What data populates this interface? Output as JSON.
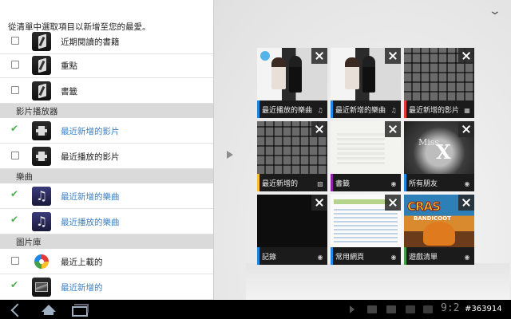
{
  "left_panel": {
    "instruction": "從清單中選取項目以新增至您的最愛。",
    "rows": [
      {
        "label": "近期閱讀的書籍",
        "checked": false,
        "icon": "books-icon",
        "style": "normal"
      },
      {
        "label": "重點",
        "checked": false,
        "icon": "books-icon",
        "style": "normal"
      },
      {
        "label": "書籤",
        "checked": false,
        "icon": "books-icon",
        "style": "normal"
      },
      {
        "label": "最近新增的影片",
        "checked": true,
        "icon": "video-icon",
        "style": "blue"
      },
      {
        "label": "最近播放的影片",
        "checked": false,
        "icon": "video-icon",
        "style": "normal"
      },
      {
        "label": "最近新增的樂曲",
        "checked": true,
        "icon": "music-icon",
        "style": "blue"
      },
      {
        "label": "最近播放的樂曲",
        "checked": true,
        "icon": "music-icon",
        "style": "blue"
      },
      {
        "label": "最近上載的",
        "checked": false,
        "icon": "picasa-icon",
        "style": "normal"
      },
      {
        "label": "最近新增的",
        "checked": true,
        "icon": "gallery-icon",
        "style": "blue"
      }
    ],
    "sections": {
      "video": "影片播放器",
      "music": "樂曲",
      "gallery": "圖片庫"
    }
  },
  "tiles": [
    {
      "caption": "最近播放的樂曲",
      "thumb": "couple-photo",
      "accent": "#1e88e5",
      "badge": "♫"
    },
    {
      "caption": "最近新增的樂曲",
      "thumb": "couple-photo",
      "accent": "#1e88e5",
      "badge": "♫"
    },
    {
      "caption": "最近新增的影片",
      "thumb": "keyboard-photo",
      "accent": "#e53935",
      "badge": "▦"
    },
    {
      "caption": "最近新增的",
      "thumb": "keyboard-photo",
      "accent": "#fbc02d",
      "badge": "▨"
    },
    {
      "caption": "書籤",
      "thumb": "document-page",
      "accent": "#8e24aa",
      "badge": "◉"
    },
    {
      "caption": "所有朋友",
      "thumb": "miss-x-image",
      "accent": "#1e88e5",
      "badge": "◉"
    },
    {
      "caption": "記錄",
      "thumb": "dark-screen",
      "accent": "#1e88e5",
      "badge": "◉"
    },
    {
      "caption": "常用網頁",
      "thumb": "web-page",
      "accent": "#1e88e5",
      "badge": "◉"
    },
    {
      "caption": "遊戲清單",
      "thumb": "crash-game-art",
      "accent": "#43a047",
      "badge": "◉"
    }
  ],
  "tile_art": {
    "miss_x_small": "Miss",
    "miss_x_big": "X",
    "crash_title": "CRAS",
    "crash_subtitle": "BANDICOOT"
  },
  "status_bar": {
    "clock": "9:2",
    "watermark": "#363914"
  },
  "colors": {
    "check_green": "#4caf50",
    "link_blue": "#3a7fc1",
    "section_bg": "#dadada"
  }
}
